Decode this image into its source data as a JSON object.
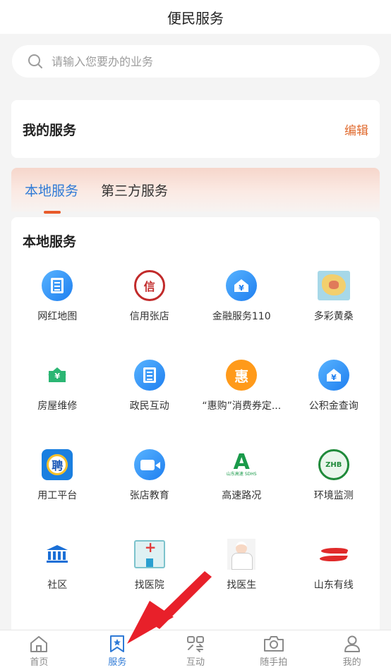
{
  "header": {
    "title": "便民服务"
  },
  "search": {
    "placeholder": "请输入您要办的业务"
  },
  "my_services": {
    "title": "我的服务",
    "edit_label": "编辑"
  },
  "tabs": [
    {
      "label": "本地服务",
      "active": true
    },
    {
      "label": "第三方服务",
      "active": false
    }
  ],
  "local_services": {
    "title": "本地服务",
    "items": [
      {
        "label": "网红地图",
        "icon": "doc-circle-icon"
      },
      {
        "label": "信用张店",
        "icon": "credit-seal-icon"
      },
      {
        "label": "金融服务110",
        "icon": "yuan-house-circle-icon"
      },
      {
        "label": "多彩黄桑",
        "icon": "map-icon"
      },
      {
        "label": "房屋维修",
        "icon": "green-house-icon"
      },
      {
        "label": "政民互动",
        "icon": "doc-circle-icon"
      },
      {
        "label": "“惠购”消费券定...",
        "icon": "hui-gou-icon"
      },
      {
        "label": "公积金查询",
        "icon": "yuan-house-circle-icon"
      },
      {
        "label": "用工平台",
        "icon": "recruit-icon"
      },
      {
        "label": "张店教育",
        "icon": "video-icon"
      },
      {
        "label": "高速路况",
        "icon": "highway-icon"
      },
      {
        "label": "环境监测",
        "icon": "environment-icon"
      },
      {
        "label": "社区",
        "icon": "bank-building-icon"
      },
      {
        "label": "找医院",
        "icon": "hospital-icon"
      },
      {
        "label": "找医生",
        "icon": "doctor-icon"
      },
      {
        "label": "山东有线",
        "icon": "sd-cable-logo-icon"
      }
    ],
    "glyphs": {
      "credit": "信",
      "hui": "惠",
      "pin": "聘",
      "highway_sub": "山东高速 SDHS",
      "env": "ZHB"
    }
  },
  "bottom_nav": [
    {
      "label": "首页",
      "icon": "home-icon",
      "active": false
    },
    {
      "label": "服务",
      "icon": "bookmark-star-icon",
      "active": true
    },
    {
      "label": "互动",
      "icon": "interaction-icon",
      "active": false
    },
    {
      "label": "随手拍",
      "icon": "camera-icon",
      "active": false
    },
    {
      "label": "我的",
      "icon": "user-icon",
      "active": false
    }
  ],
  "colors": {
    "accent": "#2f7ad6",
    "orange": "#e06a2e",
    "annotation_arrow": "#e8202a"
  }
}
